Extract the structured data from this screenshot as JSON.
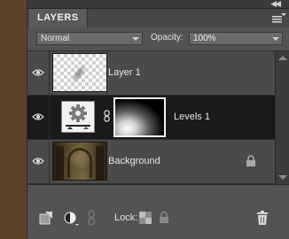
{
  "panel": {
    "title": "LAYERS",
    "collapse_glyph": "◀◀"
  },
  "options": {
    "blend_mode": "Normal",
    "opacity_label": "Opacity:",
    "opacity_value": "100%"
  },
  "layers": [
    {
      "name": "Layer 1",
      "visible": true,
      "selected": false,
      "thumbnail": "transparent-brush-stroke"
    },
    {
      "name": "Levels 1",
      "visible": true,
      "selected": true,
      "thumbnail": "levels-adjustment-icon",
      "has_mask": true
    },
    {
      "name": "Background",
      "visible": true,
      "selected": false,
      "thumbnail": "ruined-building-photo",
      "locked": true
    }
  ],
  "bottom_bar": {
    "lock_label": "Lock:",
    "icons": [
      "new-layer-icon",
      "adjustment-layer-icon",
      "link-layers-icon",
      "lock-transparency-icon",
      "lock-all-icon",
      "trash-icon"
    ]
  },
  "colors": {
    "panel_bg": "#545454",
    "selected_row": "#1a1a1a",
    "background_edge": "#5a4326"
  }
}
